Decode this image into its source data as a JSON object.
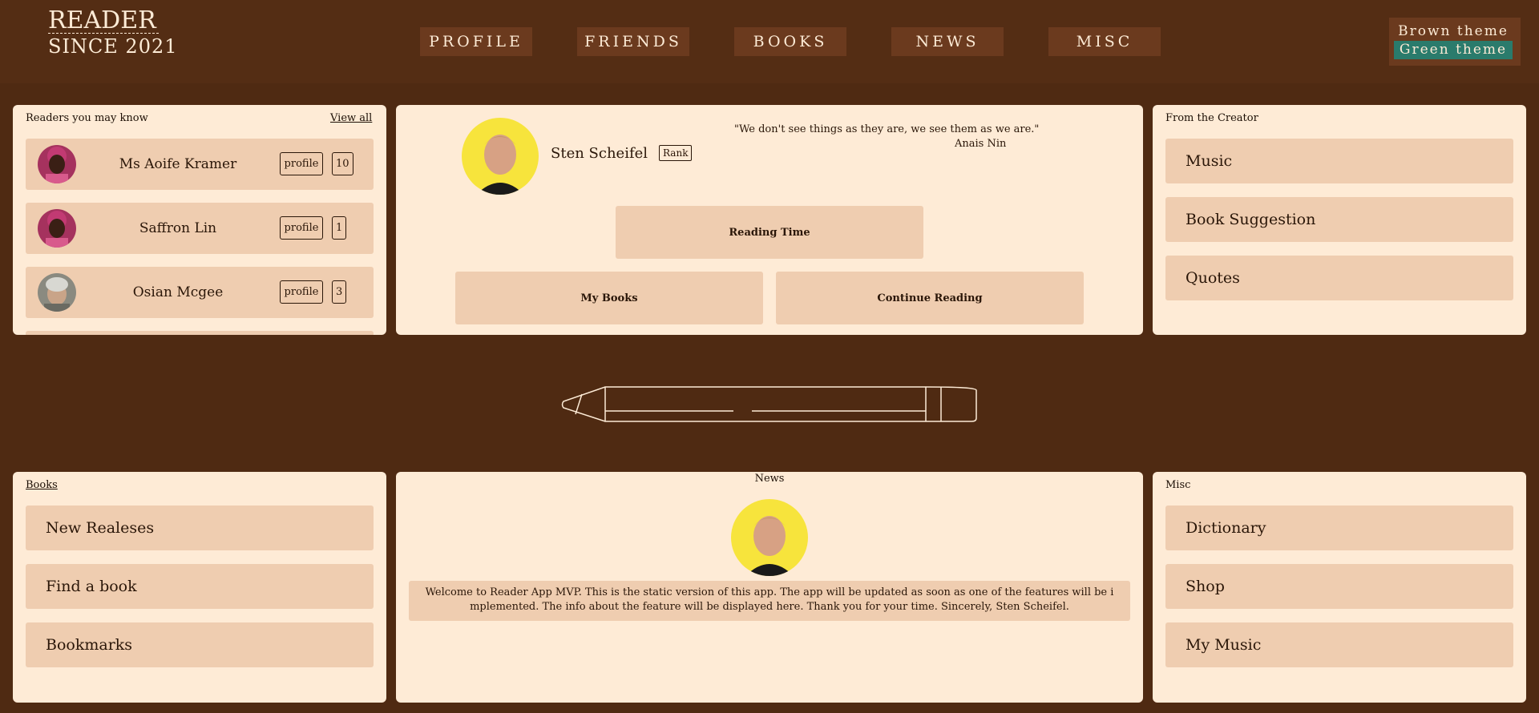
{
  "logo": {
    "line1": "READER",
    "line2": "SINCE 2021"
  },
  "nav": [
    "PROFILE",
    "FRIENDS",
    "BOOKS",
    "NEWS",
    "MISC"
  ],
  "theme": {
    "brown": "Brown theme",
    "green": "Green theme"
  },
  "readers": {
    "title": "Readers you may know",
    "view_all": "View all",
    "items": [
      {
        "name": "Ms Aoife Kramer",
        "profile": "profile",
        "count": "10"
      },
      {
        "name": "Saffron Lin",
        "profile": "profile",
        "count": "1"
      },
      {
        "name": "Osian Mcgee",
        "profile": "profile",
        "count": "3"
      }
    ]
  },
  "profile": {
    "name": "Sten Scheifel",
    "rank": "Rank",
    "quote": "\"We don't see things as they are, we see them as we are.\"",
    "quote_author": "Anais Nin",
    "reading_time": "Reading Time",
    "my_books": "My Books",
    "continue_reading": "Continue Reading"
  },
  "creator": {
    "title": "From the Creator",
    "items": [
      "Music",
      "Book Suggestion",
      "Quotes"
    ]
  },
  "books": {
    "title": "Books",
    "items": [
      "New Realeses",
      "Find a book",
      "Bookmarks"
    ]
  },
  "news": {
    "title": "News",
    "text": "Welcome to Reader App MVP. This is the static version of this app. The app will be updated as soon as one of the features will be i mplemented. The info about the feature will be displayed here. Thank you for your time. Sincerely, Sten Scheifel."
  },
  "misc": {
    "title": "Misc",
    "items": [
      "Dictionary",
      "Shop",
      "My Music"
    ]
  },
  "colors": {
    "background": "#4f2a12",
    "card": "#feebd6",
    "tile": "#efcdb0",
    "green_theme": "#2a7b6c"
  }
}
